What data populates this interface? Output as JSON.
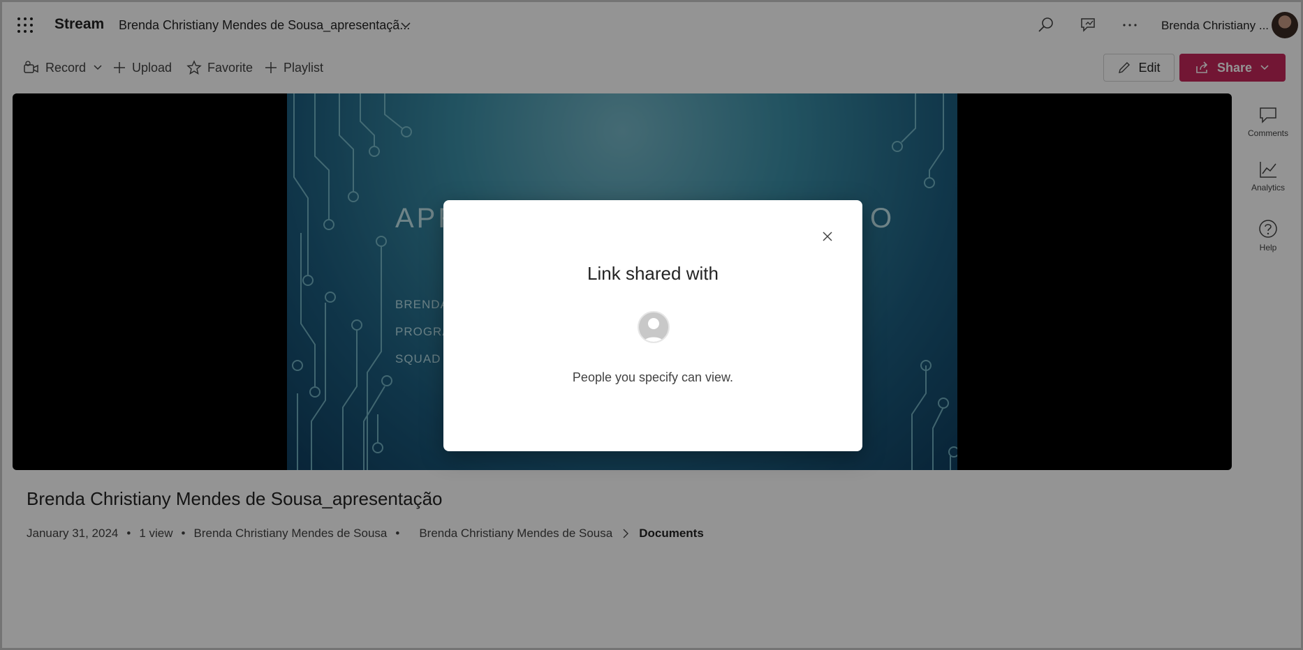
{
  "header": {
    "app_name": "Stream",
    "document_title": "Brenda Christiany Mendes de Sousa_apresentaçã...",
    "user_name": "Brenda Christiany ..."
  },
  "toolbar": {
    "record_label": "Record",
    "upload_label": "Upload",
    "favorite_label": "Favorite",
    "playlist_label": "Playlist",
    "edit_label": "Edit",
    "share_label": "Share"
  },
  "slide": {
    "title_start": "APR",
    "title_end": "O",
    "line1": "BRENDA",
    "line2": "PROGRA",
    "line3": "SQUAD 5"
  },
  "rail": {
    "comments_label": "Comments",
    "analytics_label": "Analytics",
    "help_label": "Help"
  },
  "video": {
    "title": "Brenda Christiany Mendes de Sousa_apresentação",
    "date": "January 31, 2024",
    "views": "1 view",
    "owner": "Brenda Christiany Mendes de Sousa",
    "location_parent": "Brenda Christiany Mendes de Sousa",
    "location_folder": "Documents"
  },
  "dialog": {
    "title": "Link shared with",
    "description": "People you specify can view."
  },
  "colors": {
    "share_button": "#c4265b",
    "overlay": "rgba(0,0,0,0.42)"
  }
}
